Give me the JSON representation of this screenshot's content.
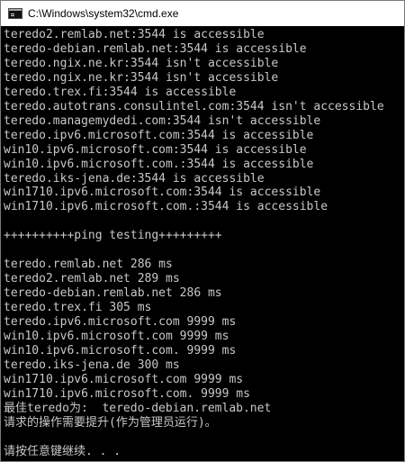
{
  "window": {
    "title": "C:\\Windows\\system32\\cmd.exe",
    "icon": "console-icon"
  },
  "console": {
    "lines": [
      "teredo2.remlab.net:3544 is accessible",
      "teredo-debian.remlab.net:3544 is accessible",
      "teredo.ngix.ne.kr:3544 isn't accessible",
      "teredo.ngix.ne.kr:3544 isn't accessible",
      "teredo.trex.fi:3544 is accessible",
      "teredo.autotrans.consulintel.com:3544 isn't accessible",
      "teredo.managemydedi.com:3544 isn't accessible",
      "teredo.ipv6.microsoft.com:3544 is accessible",
      "win10.ipv6.microsoft.com:3544 is accessible",
      "win10.ipv6.microsoft.com.:3544 is accessible",
      "teredo.iks-jena.de:3544 is accessible",
      "win1710.ipv6.microsoft.com:3544 is accessible",
      "win1710.ipv6.microsoft.com.:3544 is accessible",
      "",
      "++++++++++ping testing+++++++++",
      "",
      "teredo.remlab.net 286 ms",
      "teredo2.remlab.net 289 ms",
      "teredo-debian.remlab.net 286 ms",
      "teredo.trex.fi 305 ms",
      "teredo.ipv6.microsoft.com 9999 ms",
      "win10.ipv6.microsoft.com 9999 ms",
      "win10.ipv6.microsoft.com. 9999 ms",
      "teredo.iks-jena.de 300 ms",
      "win1710.ipv6.microsoft.com 9999 ms",
      "win1710.ipv6.microsoft.com. 9999 ms",
      "最佳teredo为:  teredo-debian.remlab.net",
      "请求的操作需要提升(作为管理员运行)。",
      "",
      "请按任意键继续. . ."
    ]
  }
}
